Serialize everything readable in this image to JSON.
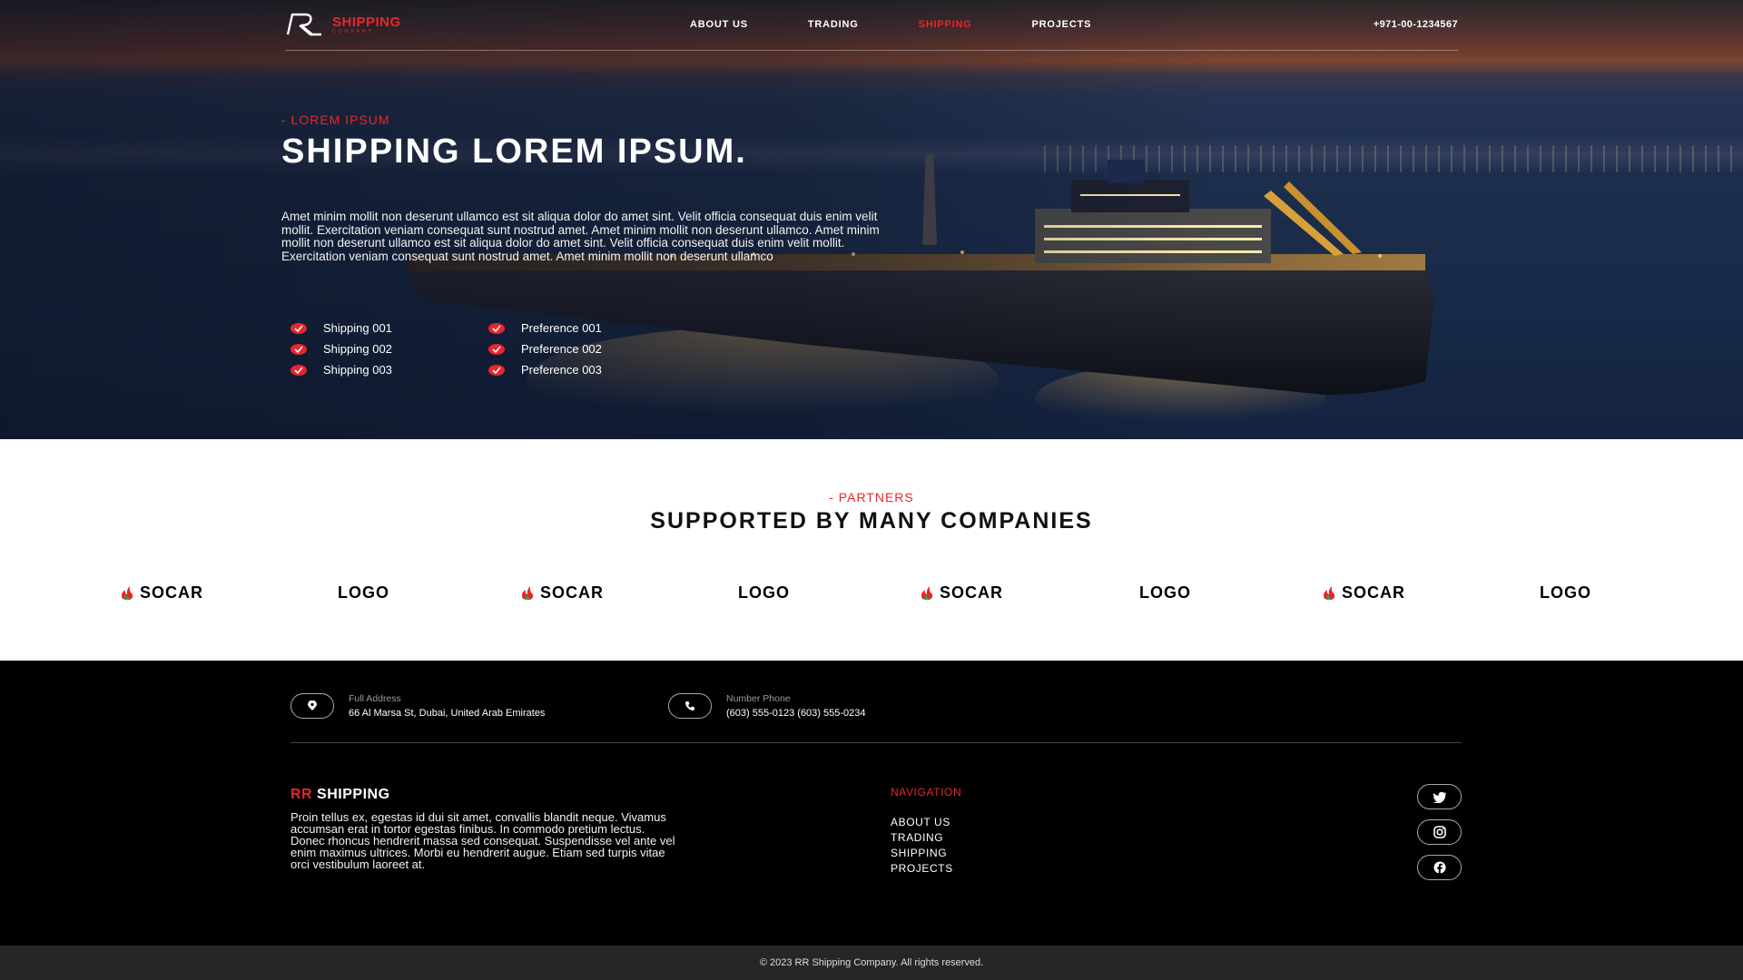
{
  "header": {
    "logo_text": "SHIPPING",
    "logo_sub": "COMPANY",
    "nav": [
      "ABOUT US",
      "TRADING",
      "SHIPPING",
      "PROJECTS"
    ],
    "active_nav": "SHIPPING",
    "phone": "+971-00-1234567"
  },
  "hero": {
    "eyebrow": "- LOREM IPSUM",
    "title": "SHIPPING LOREM IPSUM.",
    "text": "Amet minim mollit non deserunt ullamco est sit aliqua dolor do amet sint. Velit officia consequat duis enim velit mollit. Exercitation veniam consequat sunt nostrud amet. Amet minim mollit non deserunt ullamco. Amet minim mollit non deserunt ullamco est sit aliqua dolor do amet sint. Velit officia consequat duis enim velit mollit. Exercitation veniam consequat sunt nostrud amet. Amet minim mollit non deserunt ullamco",
    "features": [
      "Shipping 001",
      "Preference 001",
      "Shipping 002",
      "Preference 002",
      "Shipping 003",
      "Preference 003"
    ]
  },
  "partners": {
    "eyebrow": "- PARTNERS",
    "title": "SUPPORTED BY MANY COMPANIES",
    "logos": [
      "SOCAR",
      "LOGO",
      "SOCAR",
      "LOGO",
      "SOCAR",
      "LOGO",
      "SOCAR",
      "LOGO"
    ]
  },
  "footer": {
    "address_label": "Full Address",
    "address": "66 Al Marsa St, Dubai, United Arab Emirates",
    "phone_label": "Number Phone",
    "phone": "(603) 555-0123 (603) 555-0234",
    "brand_rr": "RR",
    "brand_name": " SHIPPING",
    "brand_text": "Proin tellus ex, egestas id dui sit amet, convallis blandit neque. Vivamus accumsan erat in tortor egestas finibus. In commodo pretium lectus. Donec rhoncus hendrerit massa sed consequat. Suspendisse vel ante vel enim maximus ultrices. Morbi eu hendrerit augue. Etiam sed turpis vitae orci vestibulum laoreet at.",
    "nav_title": "NAVIGATION",
    "nav_links": [
      "ABOUT US",
      "TRADING",
      "SHIPPING",
      "PROJECTS"
    ],
    "social_icons": [
      "twitter-icon",
      "instagram-icon",
      "facebook-icon"
    ],
    "copyright": "© 2023 RR Shipping Company. All rights reserved."
  },
  "colors": {
    "accent": "#e8262b",
    "footer_bg": "#000000",
    "copyright_bg": "#262626"
  }
}
